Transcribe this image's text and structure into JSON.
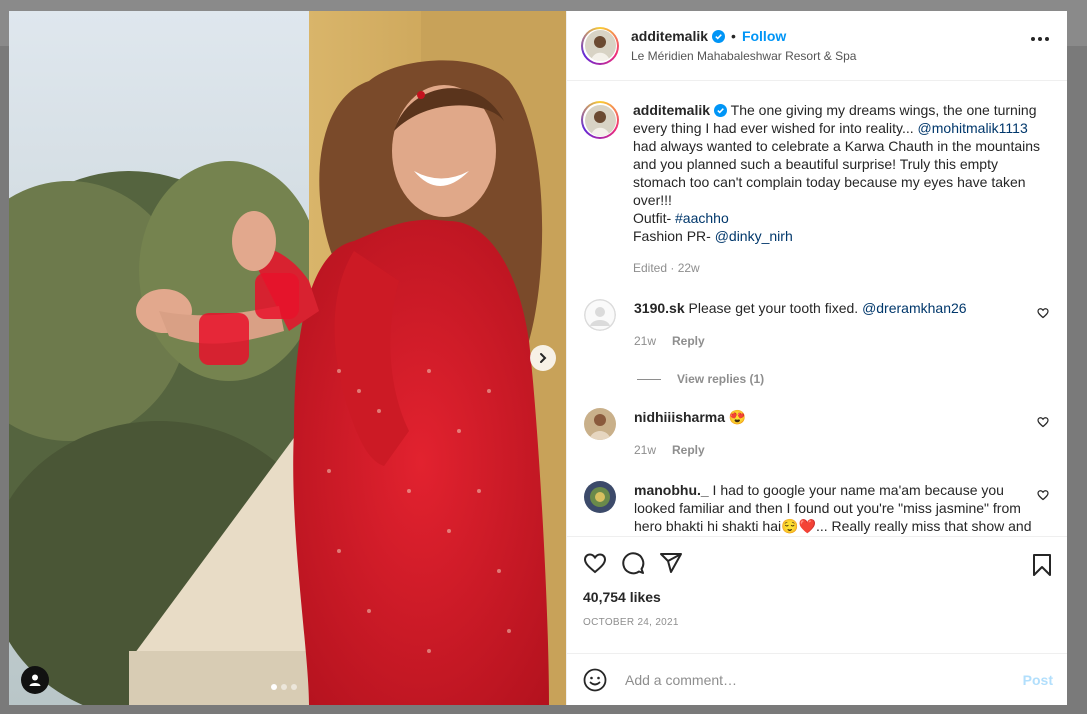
{
  "post": {
    "username": "additemalik",
    "separator": "•",
    "follow_label": "Follow",
    "location": "Le Méridien Mahabaleshwar Resort & Spa"
  },
  "caption": {
    "username": "additemalik",
    "text_1": " The one giving my dreams wings, the one turning every thing I had ever wished for into reality... ",
    "mention_1": "@mohitmalik1113",
    "text_2": " had always wanted to celebrate a Karwa Chauth in the mountains and you planned such a beautiful surprise! Truly this empty stomach too can't complain today because my eyes have taken over!!!",
    "outfit_label": "Outfit- ",
    "hashtag": "#aachho",
    "pr_label": "Fashion PR- ",
    "mention_2": "@dinky_nirh",
    "edited": "Edited",
    "meta_sep": " · ",
    "age": "22w"
  },
  "comments": [
    {
      "username": "3190.sk",
      "text": " Please get your tooth fixed. ",
      "mention": "@dreramkhan26",
      "age": "21w",
      "reply_label": "Reply"
    },
    {
      "username": "nidhiiisharma",
      "text": " 😍",
      "age": "21w",
      "reply_label": "Reply"
    },
    {
      "username": "manobhu._",
      "text": " I had to google your name ma'am because you looked familiar and then I found out you're \"miss jasmine\" from hero bhakti hi shakti hai😌❤️... Really really miss that show and"
    }
  ],
  "view_replies_label": "View replies (1)",
  "likes": "40,754 likes",
  "date": "OCTOBER 24, 2021",
  "add_comment": {
    "placeholder": "Add a comment…",
    "post_label": "Post"
  },
  "icons": {
    "verified": "verified-badge-icon",
    "more": "more-options-icon",
    "like": "heart-icon",
    "comment": "comment-icon",
    "share": "share-icon",
    "save": "bookmark-icon",
    "emoji": "emoji-icon",
    "next": "chevron-right-icon",
    "user_tag": "user-tag-icon"
  },
  "colors": {
    "accent": "#0095f6",
    "link": "#00376b",
    "muted": "#8e8e8e",
    "text": "#262626"
  }
}
